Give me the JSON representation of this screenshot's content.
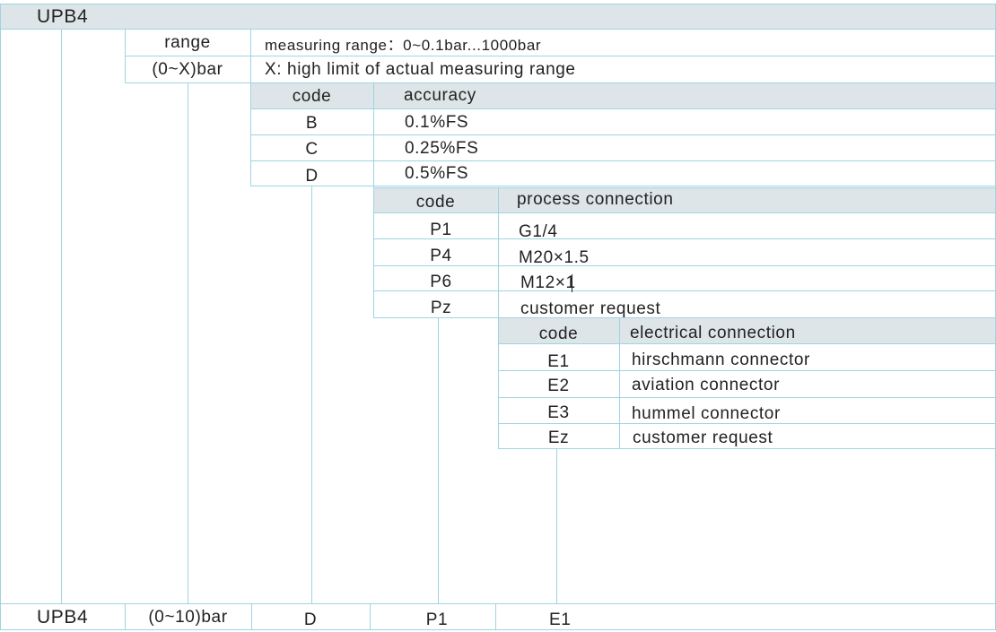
{
  "model": "UPB4",
  "range": {
    "header": "range",
    "unit_code": "(0~X)bar",
    "description": "measuring range：0~0.1bar...1000bar",
    "x_note": "X: high  limit  of  actual measuring range"
  },
  "accuracy": {
    "code_header": "code",
    "header": "accuracy",
    "rows": [
      {
        "code": "B",
        "value": "0.1%FS"
      },
      {
        "code": "C",
        "value": "0.25%FS"
      },
      {
        "code": "D",
        "value": "0.5%FS"
      }
    ]
  },
  "process_connection": {
    "code_header": "code",
    "header": "process  connection",
    "rows": [
      {
        "code": "P1",
        "value": "G1/4"
      },
      {
        "code": "P4",
        "value": "M20×1.5"
      },
      {
        "code": "P6",
        "value": "M12×1"
      },
      {
        "code": "Pz",
        "value": "customer request"
      }
    ]
  },
  "electrical_connection": {
    "code_header": "code",
    "header": "electrical connection",
    "rows": [
      {
        "code": "E1",
        "value": "hirschmann connector"
      },
      {
        "code": "E2",
        "value": "aviation  connector"
      },
      {
        "code": "E3",
        "value": "hummel connector"
      },
      {
        "code": "Ez",
        "value": "customer request"
      }
    ]
  },
  "example": {
    "model": "UPB4",
    "range": "(0~10)bar",
    "accuracy": "D",
    "process": "P1",
    "electrical": "E1"
  },
  "colors": {
    "line": "#9fd3e3",
    "header_band": "#dde5e8",
    "text": "#222222"
  }
}
